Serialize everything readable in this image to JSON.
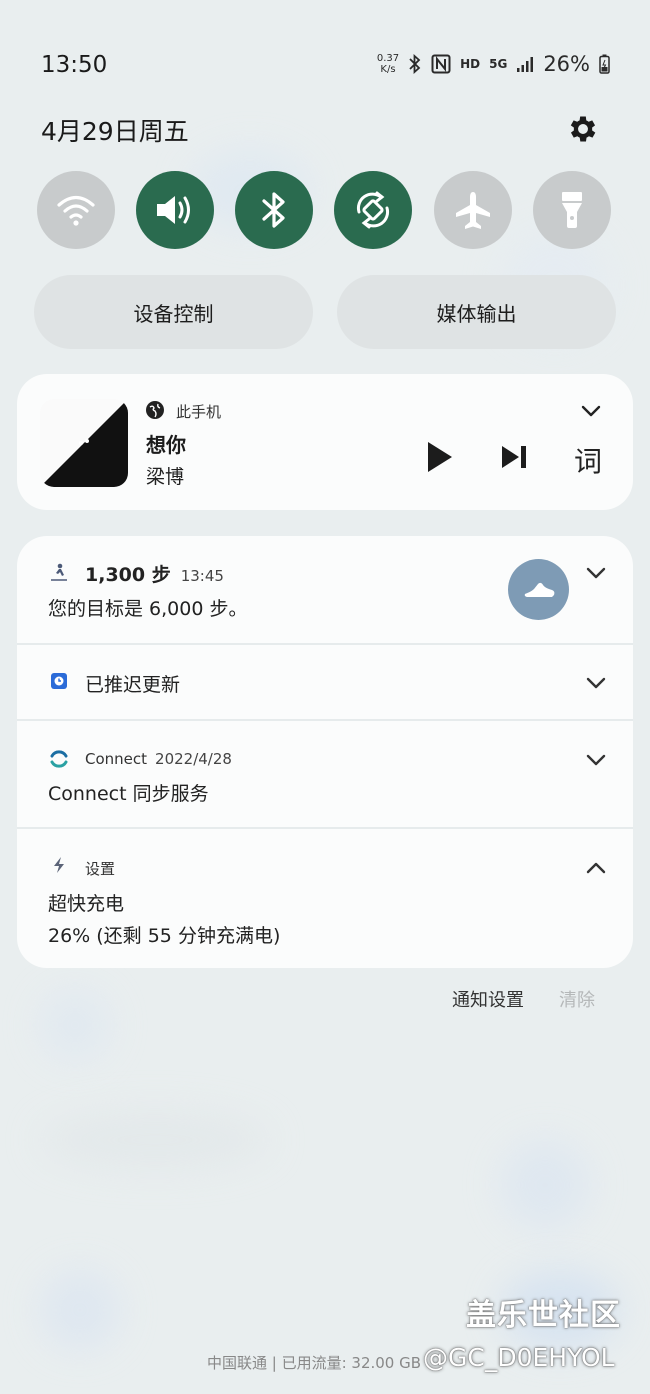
{
  "status_bar": {
    "time": "13:50",
    "net_speed_value": "0.37",
    "net_speed_unit": "K/s",
    "hd_label": "HD",
    "network_label": "5G",
    "battery": "26%",
    "icons": [
      "bluetooth-icon",
      "nfc-icon",
      "signal-icon",
      "battery-icon"
    ]
  },
  "header": {
    "date": "4月29日周五",
    "settings_icon": "gear-icon"
  },
  "quick_toggles": [
    {
      "name": "wifi",
      "icon": "wifi-icon",
      "state": "off"
    },
    {
      "name": "sound",
      "icon": "speaker-icon",
      "state": "on"
    },
    {
      "name": "bluetooth",
      "icon": "bluetooth-icon",
      "state": "on"
    },
    {
      "name": "auto-rotate",
      "icon": "rotate-icon",
      "state": "on"
    },
    {
      "name": "airplane",
      "icon": "airplane-icon",
      "state": "off"
    },
    {
      "name": "flashlight",
      "icon": "flashlight-icon",
      "state": "off"
    }
  ],
  "pills": {
    "device_control": "设备控制",
    "media_output": "媒体输出"
  },
  "media": {
    "source": "此手机",
    "title": "想你",
    "artist": "梁博",
    "lyrics_button": "词",
    "controls": [
      "play-icon",
      "skip-next-icon"
    ]
  },
  "notifications": {
    "steps": {
      "title": "1,300 步",
      "time": "13:45",
      "body": "您的目标是 6,000 步。"
    },
    "update": {
      "title": "已推迟更新"
    },
    "connect": {
      "app": "Connect",
      "date": "2022/4/28",
      "body": "Connect 同步服务"
    },
    "charging": {
      "app": "设置",
      "title": "超快充电",
      "body": "26% (还剩 55 分钟充满电)"
    }
  },
  "actions": {
    "notification_settings": "通知设置",
    "clear": "清除"
  },
  "footer": {
    "carrier": "中国联通 | 已用流量: 32.00 GB"
  },
  "watermark": {
    "line1": "盖乐世社区",
    "line2": "@GC_D0EHYOL"
  },
  "colors": {
    "toggle_on": "#2a6b4f",
    "toggle_off": "#c8cbcc",
    "shoe_button": "#7e9bb5"
  }
}
